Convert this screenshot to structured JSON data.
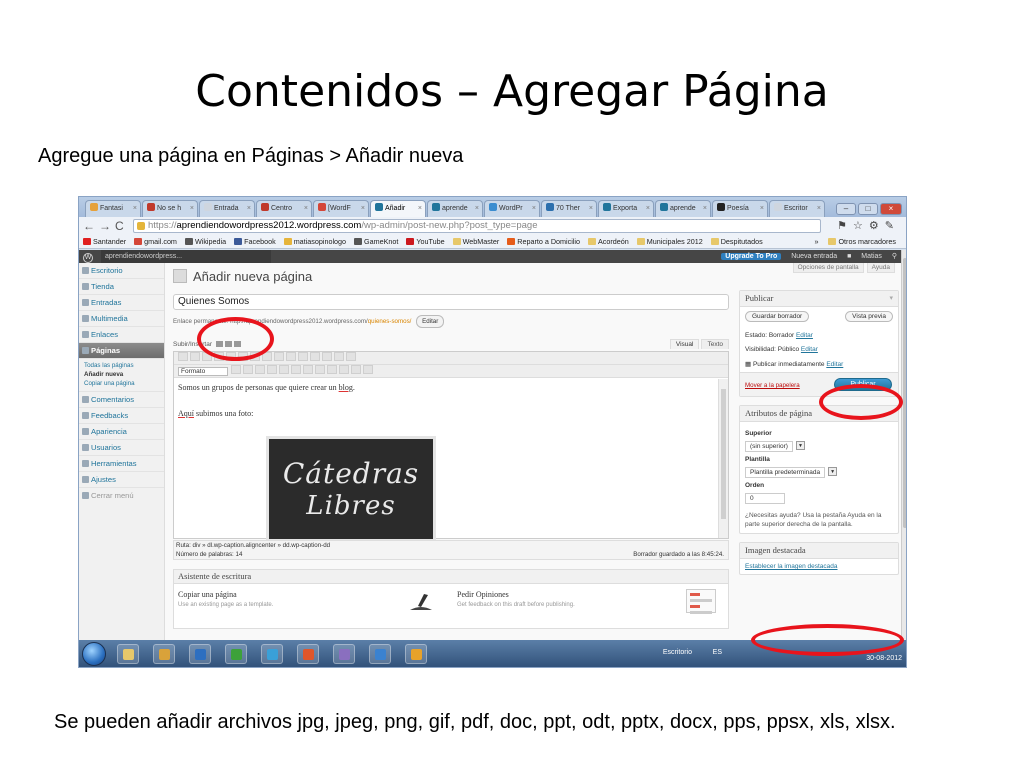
{
  "slide": {
    "title": "Contenidos – Agregar Página",
    "subtitle": "Agregue una página en Páginas > Añadir nueva",
    "footer": "Se pueden añadir archivos jpg, jpeg, png, gif, pdf, doc, ppt, odt, pptx, docx, pps, ppsx, xls, xlsx."
  },
  "browser": {
    "tabs": [
      {
        "label": "Fantasi",
        "color": "#e6a13a"
      },
      {
        "label": "No se h",
        "color": "#c0392b"
      },
      {
        "label": "Entrada",
        "color": "#cfd6df"
      },
      {
        "label": "Centro",
        "color": "#c0392b"
      },
      {
        "label": "[WordF",
        "color": "#d44638"
      },
      {
        "label": "Añadir",
        "color": "#21759b",
        "active": true
      },
      {
        "label": "aprende",
        "color": "#21759b"
      },
      {
        "label": "WordPr",
        "color": "#3b8dd0"
      },
      {
        "label": "70 Ther",
        "color": "#2c6fad"
      },
      {
        "label": "Exporta",
        "color": "#21759b"
      },
      {
        "label": "aprende",
        "color": "#21759b"
      },
      {
        "label": "Poesía",
        "color": "#222222"
      },
      {
        "label": "Escritor",
        "color": "#cfd6df"
      }
    ],
    "url_scheme": "https://",
    "url_host": "aprendiendowordpress2012.wordpress.com",
    "url_path": "/wp-admin/post-new.php?post_type=page",
    "bookmarks": [
      {
        "label": "Santander",
        "color": "#e02020"
      },
      {
        "label": "gmail.com",
        "color": "#d44638"
      },
      {
        "label": "Wikipedia",
        "color": "#555555"
      },
      {
        "label": "Facebook",
        "color": "#3b5998"
      },
      {
        "label": "matiasopinologo",
        "color": "#e6b43a"
      },
      {
        "label": "GameKnot",
        "color": "#555555"
      },
      {
        "label": "YouTube",
        "color": "#cc181e"
      },
      {
        "label": "WebMaster",
        "color": "#e7c86a"
      },
      {
        "label": "Reparto a Domicilio",
        "color": "#e65c1a"
      },
      {
        "label": "Acordeón",
        "color": "#e7c86a"
      },
      {
        "label": "Municipales 2012",
        "color": "#e7c86a"
      },
      {
        "label": "Despitutados",
        "color": "#e7c86a"
      }
    ],
    "bookmarks_more": "»",
    "other_bookmarks": "Otros marcadores"
  },
  "adminbar": {
    "site": "aprendiendowordpress...",
    "upgrade": "Upgrade To Pro",
    "new_entry": "Nueva entrada",
    "user": "Matias"
  },
  "sidebar": {
    "items": [
      {
        "label": "Escritorio"
      },
      {
        "label": "Tienda"
      },
      {
        "label": "Entradas"
      },
      {
        "label": "Multimedia"
      },
      {
        "label": "Enlaces"
      },
      {
        "label": "Páginas",
        "active": true
      }
    ],
    "subitems": [
      "Todas las páginas",
      "Añadir nueva",
      "Copiar una página"
    ],
    "items2": [
      {
        "label": "Comentarios"
      },
      {
        "label": "Feedbacks"
      },
      {
        "label": "Apariencia"
      },
      {
        "label": "Usuarios"
      },
      {
        "label": "Herramientas"
      },
      {
        "label": "Ajustes"
      }
    ],
    "collapse": "Cerrar menú"
  },
  "page": {
    "heading": "Añadir nueva página",
    "screen_options": "Opciones de pantalla",
    "help": "Ayuda",
    "title_value": "Quienes Somos",
    "permalink_label": "Enlace permanente:",
    "permalink_base": "http://aprendiendowordpress2012.wordpress.com/",
    "permalink_slug": "quienes-somos/",
    "permalink_edit": "Editar",
    "upload_label": "Subir/Insertar",
    "tab_visual": "Visual",
    "tab_text": "Texto",
    "format_label": "Formato",
    "body_line1_pre": "Somos un grupos de personas que quiere crear un ",
    "body_line1_word": "blog",
    "body_line1_post": ".",
    "body_line2_word": "Aquí",
    "body_line2_post": " subimos una foto:",
    "image_line1": "Cátedras",
    "image_line2": "Libres",
    "path_text": "Ruta: div » dl.wp-caption.aligncenter » dd.wp-caption-dd",
    "word_count": "Número de palabras: 14",
    "draft_saved": "Borrador guardado a las 8:45:24.",
    "assistant_title": "Asistente de escritura",
    "copy_title": "Copiar una página",
    "copy_desc": "Use an existing page as a template.",
    "feedback_title": "Pedir Opiniones",
    "feedback_desc": "Get feedback on this draft before publishing."
  },
  "publish": {
    "title": "Publicar",
    "save_draft": "Guardar borrador",
    "preview": "Vista previa",
    "status": "Estado: Borrador",
    "visibility": "Visibilidad: Público",
    "edit": "Editar",
    "schedule": "Publicar inmediatamente",
    "trash": "Mover a la papelera",
    "publish": "Publicar"
  },
  "attributes": {
    "title": "Atributos de página",
    "parent_label": "Superior",
    "parent_value": "(sin superior)",
    "template_label": "Plantilla",
    "template_value": "Plantilla predeterminada",
    "order_label": "Orden",
    "order_value": "0",
    "help_text": "¿Necesitas ayuda? Usa la pestaña Ayuda en la parte superior derecha de la pantalla."
  },
  "featured": {
    "title": "Imagen destacada",
    "link": "Establecer la imagen destacada"
  },
  "taskbar": {
    "desktop": "Escritorio",
    "lang": "ES",
    "date": "30-08-2012"
  },
  "colors": {
    "annotation_ring": "#e8141c",
    "wp_blue": "#21759b",
    "admin_bar": "#464646"
  }
}
